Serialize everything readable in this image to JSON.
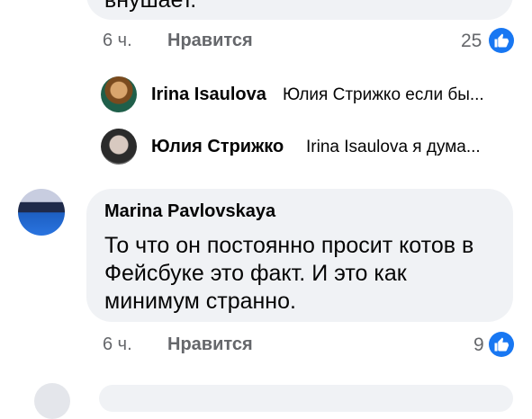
{
  "top_comment": {
    "cut_text": "внушает.",
    "time": "6 ч.",
    "like_label": "Нравится",
    "reaction_count": "25"
  },
  "replies": [
    {
      "author": "Irina Isaulova",
      "snippet": "Юлия Стрижко если бы..."
    },
    {
      "author": "Юлия Стрижко",
      "snippet": "Irina Isaulova я дума..."
    }
  ],
  "comment": {
    "author": "Marina Pavlovskaya",
    "text": "То что он постоянно просит котов в Фейсбуке это факт. И это как минимум странно.",
    "time": "6 ч.",
    "like_label": "Нравится",
    "reaction_count": "9"
  },
  "colors": {
    "bubble": "#f0f2f5",
    "like_blue": "#1877f2",
    "meta_gray": "#65676b"
  },
  "icons": {
    "reaction": "like-thumb-icon"
  }
}
